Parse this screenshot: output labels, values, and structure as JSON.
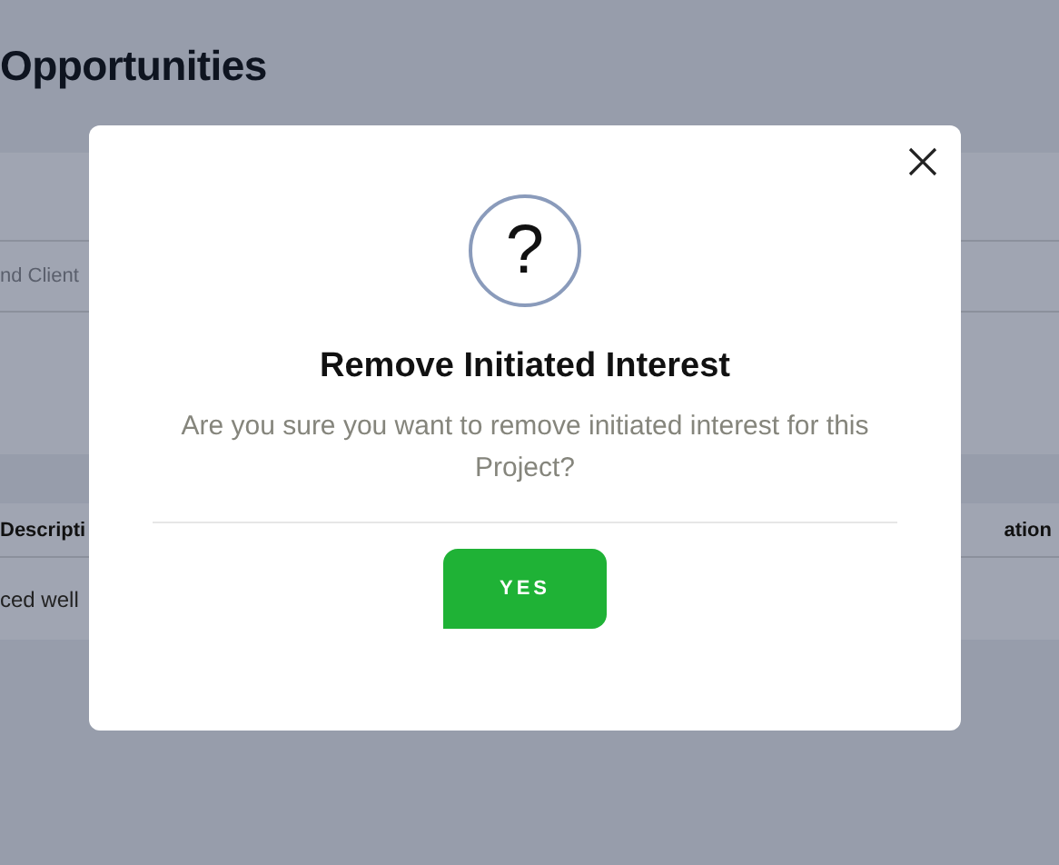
{
  "page": {
    "title": "Opportunities",
    "search_placeholder": "nd Client"
  },
  "table": {
    "columns": [
      "Descripti",
      "ation"
    ],
    "rows": [
      [
        "ced well"
      ]
    ]
  },
  "dialog": {
    "icon_text": "?",
    "title": "Remove Initiated Interest",
    "message": "Are you sure you want to remove initiated interest for this Project?",
    "buttons": [
      "YES"
    ]
  }
}
